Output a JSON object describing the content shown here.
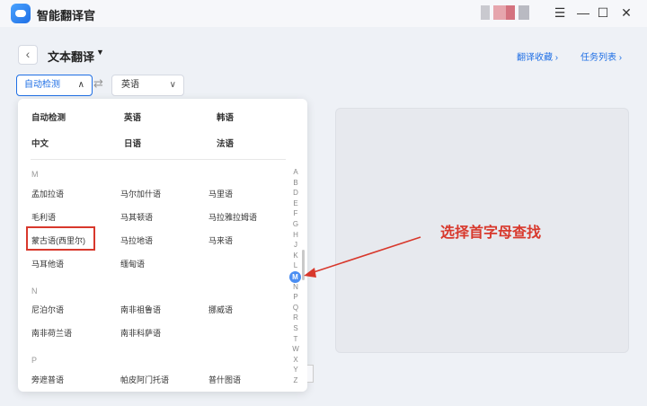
{
  "app": {
    "title": "智能翻译官",
    "window_controls": [
      "☰",
      "—",
      "☐",
      "✕"
    ]
  },
  "nav": {
    "back_icon": "‹",
    "title": "文本翻译",
    "caret": "▼",
    "favorites": "翻译收藏 ›",
    "tasks": "任务列表 ›"
  },
  "selectors": {
    "source": "自动检测",
    "source_chevron": "∧",
    "swap_icon": "⇄",
    "target": "英语",
    "target_chevron": "∨"
  },
  "popular": [
    [
      "自动检测",
      "英语",
      "韩语"
    ],
    [
      "中文",
      "日语",
      "法语"
    ]
  ],
  "groups": [
    {
      "letter": "M",
      "rows": [
        [
          "孟加拉语",
          "马尔加什语",
          "马里语"
        ],
        [
          "毛利语",
          "马其顿语",
          "马拉雅拉姆语"
        ],
        [
          "蒙古语(西里尔)",
          "马拉地语",
          "马来语"
        ],
        [
          "马耳他语",
          "缅甸语",
          ""
        ]
      ]
    },
    {
      "letter": "N",
      "rows": [
        [
          "尼泊尔语",
          "南非祖鲁语",
          "挪威语"
        ],
        [
          "南非荷兰语",
          "南非科萨语",
          ""
        ]
      ]
    },
    {
      "letter": "P",
      "rows": [
        [
          "旁遮普语",
          "帕皮阿门托语",
          "普什图语"
        ]
      ]
    }
  ],
  "alphabet": [
    "A",
    "B",
    "D",
    "E",
    "F",
    "G",
    "H",
    "J",
    "K",
    "L",
    "M",
    "N",
    "P",
    "Q",
    "R",
    "S",
    "T",
    "W",
    "X",
    "Y",
    "Z"
  ],
  "active_letter": "M",
  "annotation": "选择首字母查找",
  "colors": {
    "accent": "#1f6fe5",
    "annotation": "#d8382c",
    "active_letter_bg": "#4b8ef2"
  }
}
